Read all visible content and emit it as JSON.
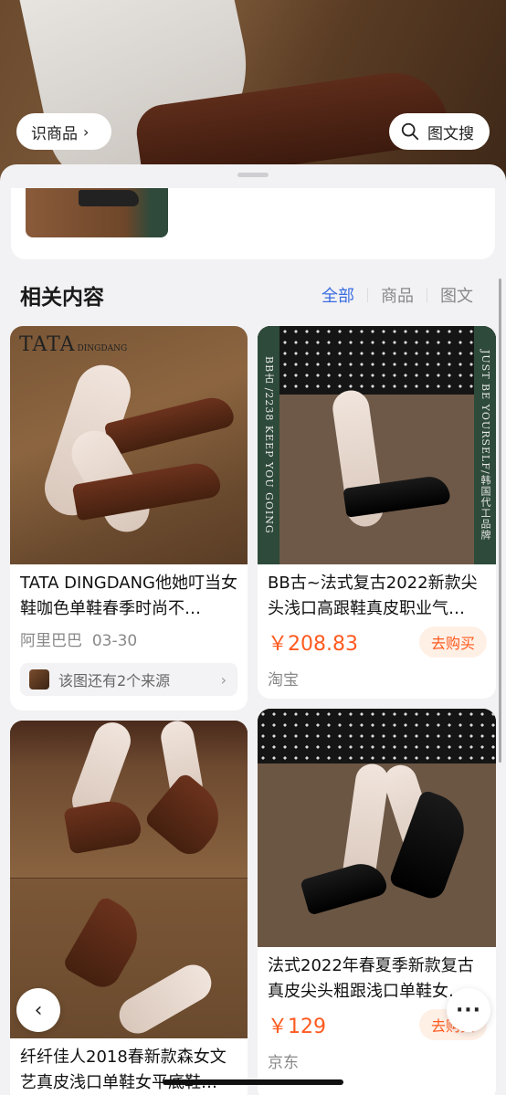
{
  "hero": {
    "identify_label": "识商品",
    "image_search_label": "图文搜"
  },
  "related": {
    "title": "相关内容",
    "tabs": [
      "全部",
      "商品",
      "图文"
    ],
    "active_tab": "全部"
  },
  "cards": [
    {
      "brand_text": "TATA",
      "brand_sub": "DINGDANG",
      "title": "TATA DINGDANG他她叮当女鞋咖色单鞋春季时尚不…",
      "source": "阿里巴巴",
      "date": "03-30",
      "more_sources": "该图还有2个来源"
    },
    {
      "band_left": "BB古 /2238 KEEP YOU GOING",
      "band_right": "JUST BE YOURSELF/韩国代工品牌",
      "title": "BB古~法式复古2022新款尖头浅口高跟鞋真皮职业气…",
      "price": "￥208.83",
      "buy_label": "去购买",
      "store": "淘宝"
    },
    {
      "title": "纤纤佳人2018春新款森女文艺真皮浅口单鞋女平底鞋…"
    },
    {
      "title": "法式2022年春夏季新款复古真皮尖头粗跟浅口单鞋女…",
      "price": "￥129",
      "buy_label": "去购买",
      "store": "京东"
    }
  ],
  "colors": {
    "accent_blue": "#3b6ce0",
    "price_orange": "#ff5a1f",
    "background": "#f2f2f4"
  },
  "icons": [
    "chevron-right-icon",
    "search-icon",
    "back-icon",
    "more-icon"
  ]
}
